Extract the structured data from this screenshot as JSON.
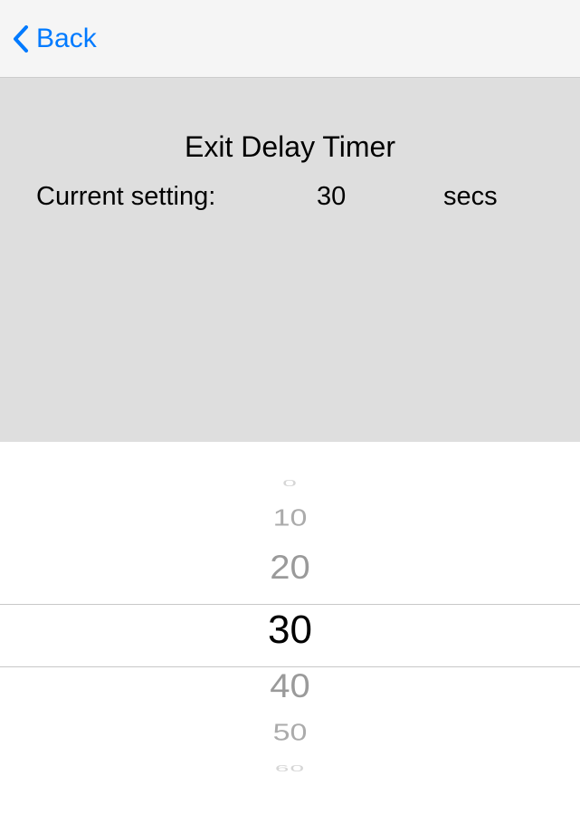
{
  "nav": {
    "back_label": "Back"
  },
  "content": {
    "title": "Exit Delay Timer",
    "setting_label": "Current setting:",
    "setting_value": "30",
    "setting_unit": "secs"
  },
  "picker": {
    "items": [
      "0",
      "10",
      "20",
      "30",
      "40",
      "50",
      "60"
    ],
    "selected_index": 3
  }
}
